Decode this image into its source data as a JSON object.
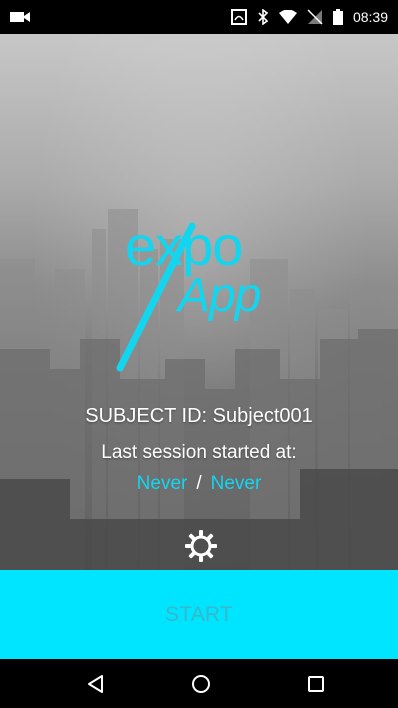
{
  "status_bar": {
    "time": "08:39",
    "icons": [
      "camera-icon",
      "nfc-icon",
      "bluetooth-icon",
      "wifi-icon",
      "no-signal-icon",
      "battery-icon"
    ]
  },
  "logo": {
    "line1": "expo",
    "line2": "App"
  },
  "subject": {
    "label": "SUBJECT ID:",
    "value": "Subject001"
  },
  "last_session": {
    "label": "Last session started at:",
    "start": "Never",
    "separator": "/",
    "end": "Never"
  },
  "actions": {
    "settings_icon": "gear-icon",
    "start_label": "START"
  },
  "nav_bar": {
    "back_icon": "back-triangle-icon",
    "home_icon": "home-circle-icon",
    "recents_icon": "recents-square-icon"
  },
  "colors": {
    "accent": "#12d6f0",
    "start_button": "#00e5ff",
    "start_text": "#39b7c9"
  }
}
